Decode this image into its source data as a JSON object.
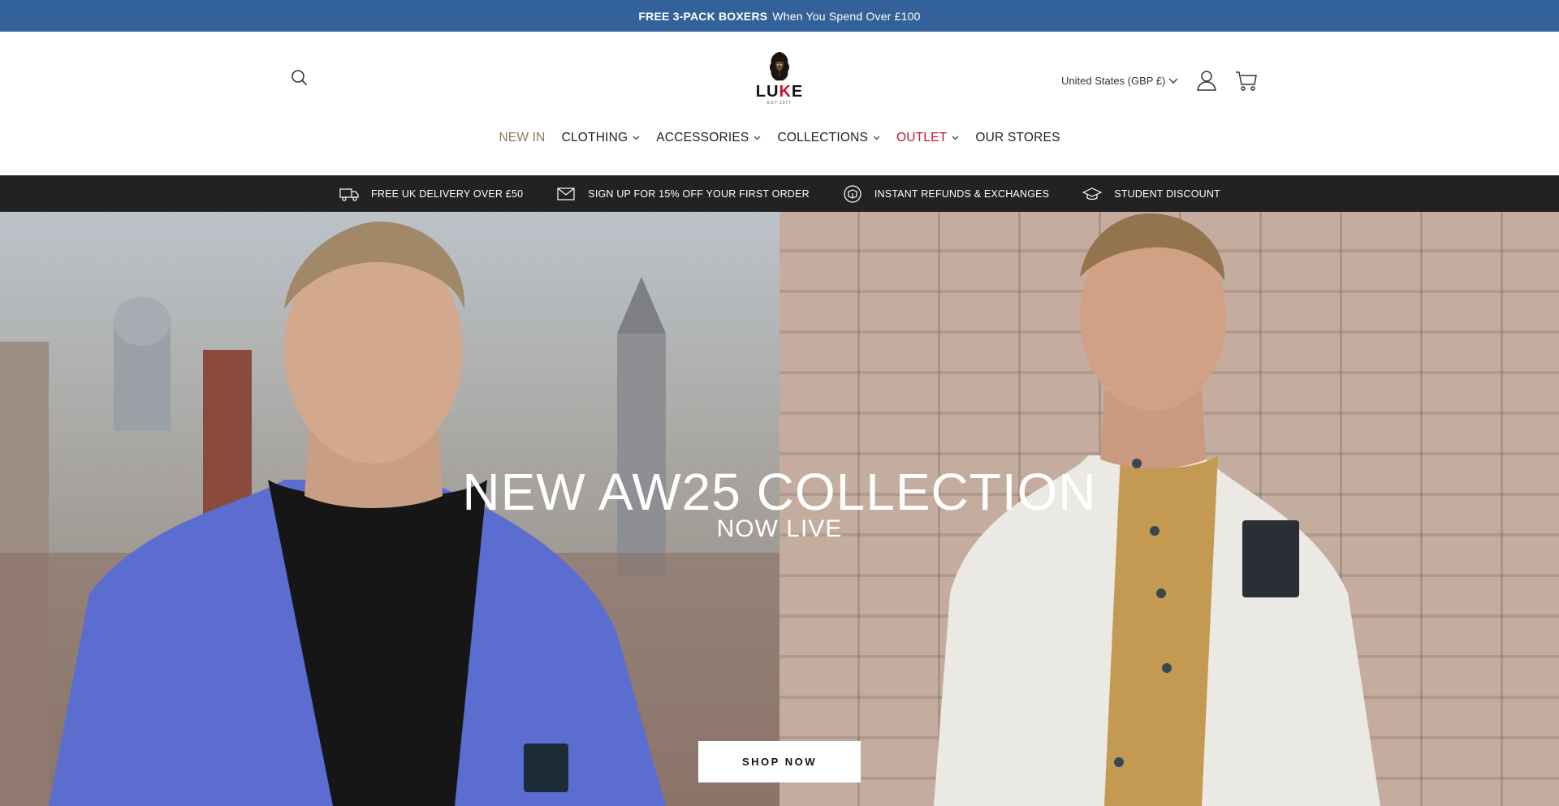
{
  "announcement": {
    "bold": "FREE 3-PACK BOXERS",
    "text": "When You Spend Over £100"
  },
  "header": {
    "logo": {
      "wordmark_1": "LU",
      "wordmark_2": "K",
      "wordmark_3": "E",
      "tagline": "EST 1977"
    },
    "locale": "United States (GBP £)",
    "icons": {
      "search": "search-icon",
      "account": "user-icon",
      "cart": "cart-icon"
    }
  },
  "nav": [
    {
      "label": "NEW IN",
      "dropdown": false
    },
    {
      "label": "CLOTHING",
      "dropdown": true
    },
    {
      "label": "ACCESSORIES",
      "dropdown": true
    },
    {
      "label": "COLLECTIONS",
      "dropdown": true
    },
    {
      "label": "OUTLET",
      "dropdown": true
    },
    {
      "label": "OUR STORES",
      "dropdown": false
    }
  ],
  "usp": [
    {
      "label": "FREE UK DELIVERY OVER £50",
      "icon": "truck-icon"
    },
    {
      "label": "SIGN UP FOR 15% OFF YOUR FIRST ORDER",
      "icon": "envelope-icon"
    },
    {
      "label": "INSTANT REFUNDS & EXCHANGES",
      "icon": "box-return-icon"
    },
    {
      "label": "STUDENT DISCOUNT",
      "icon": "graduation-cap-icon"
    }
  ],
  "hero": {
    "title": "NEW AW25 COLLECTION",
    "subtitle": "NOW LIVE",
    "cta": "SHOP NOW"
  },
  "colors": {
    "announcement_bg": "#33629a",
    "usp_bg": "#222222",
    "outlet": "#c8102e",
    "new_in": "#8a7a5e"
  }
}
